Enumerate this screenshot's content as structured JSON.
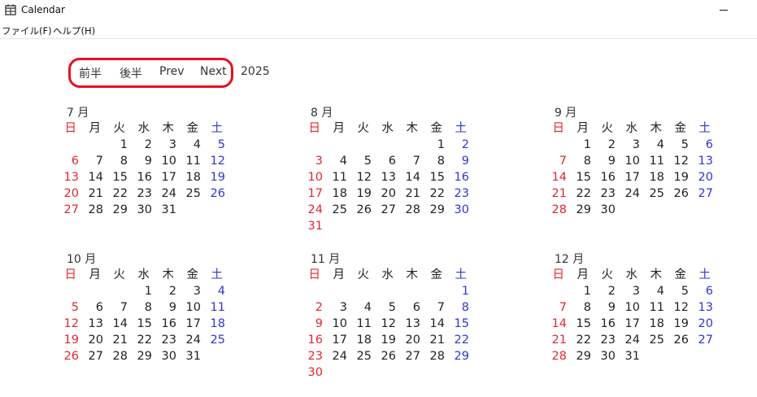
{
  "window": {
    "title": "Calendar"
  },
  "menu": [
    {
      "name": "menu-file",
      "label": "ファイル(F)"
    },
    {
      "name": "menu-help",
      "label": "ヘルプ(H)"
    }
  ],
  "nav": {
    "first_half": "前半",
    "second_half": "後半",
    "prev": "Prev",
    "next": "Next",
    "year": "2025"
  },
  "weekdays": [
    "日",
    "月",
    "火",
    "水",
    "木",
    "金",
    "土"
  ],
  "colors": {
    "sunday": "#e3262f",
    "saturday": "#3035d6",
    "highlight": "#e8101e"
  },
  "months": [
    {
      "title": "7 月",
      "first_weekday": 2,
      "days": 31
    },
    {
      "title": "8 月",
      "first_weekday": 5,
      "days": 31
    },
    {
      "title": "9 月",
      "first_weekday": 1,
      "days": 30
    },
    {
      "title": "10 月",
      "first_weekday": 3,
      "days": 31
    },
    {
      "title": "11 月",
      "first_weekday": 6,
      "days": 30
    },
    {
      "title": "12 月",
      "first_weekday": 1,
      "days": 31
    }
  ]
}
